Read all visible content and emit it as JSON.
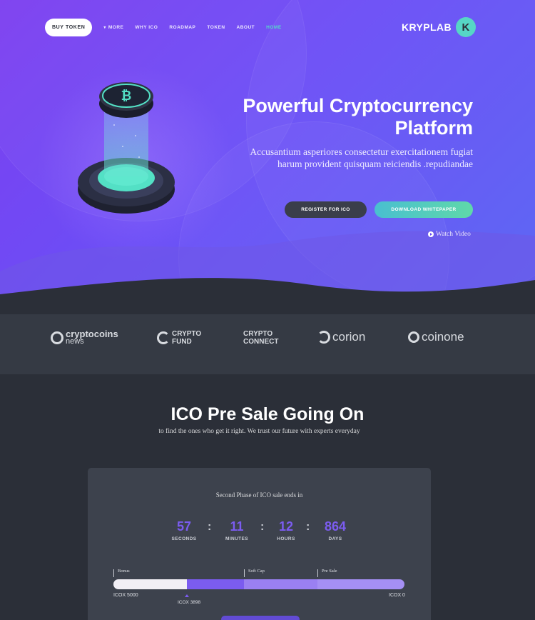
{
  "nav": {
    "buy_token": "BUY TOKEN",
    "items": [
      "MORE",
      "WHY ICO",
      "ROADMAP",
      "TOKEN",
      "ABOUT",
      "HOME"
    ],
    "active": "HOME"
  },
  "logo": {
    "text": "KRYPLAB",
    "badge": "K"
  },
  "hero": {
    "title_line1": "Powerful Cryptocurrency",
    "title_line2": "Platform",
    "subtitle": "Accusantium asperiores consectetur exercitationem fugiat harum provident quisquam reiciendis .repudiandae",
    "register_button": "REGISTER FOR ICO",
    "download_button": "DOWNLOAD WHITEPAPER",
    "watch_video": "Watch Video"
  },
  "partners": [
    {
      "name": "cryptocoins",
      "sub": "news"
    },
    {
      "name": "CRYPTO",
      "sub": "FUND"
    },
    {
      "name": "CRYPTO",
      "sub": "CONNECT"
    },
    {
      "name": "corion",
      "sub": ""
    },
    {
      "name": "coinone",
      "sub": ""
    }
  ],
  "presale": {
    "title": "ICO Pre Sale Going On",
    "subtitle": "to find the ones who get it right. We trust our future with experts everyday",
    "card_label": "Second Phase of ICO sale ends in",
    "countdown": [
      {
        "value": "57",
        "unit": "SECONDS"
      },
      {
        "value": "11",
        "unit": "MINUTES"
      },
      {
        "value": "12",
        "unit": "HOURS"
      },
      {
        "value": "864",
        "unit": "DAYS"
      }
    ],
    "progress": {
      "bonus_label": "Bonus",
      "soft_cap_label": "Soft Cap",
      "pre_sale_label": "Pre Sale",
      "left_value": "ICOX 5000",
      "right_value": "ICOX 0",
      "current_value": "ICOX 3898",
      "current_fraction": 0.22
    }
  },
  "colors": {
    "accent": "#7b5cf0",
    "teal": "#56d6c6",
    "dark": "#2b2f38"
  }
}
